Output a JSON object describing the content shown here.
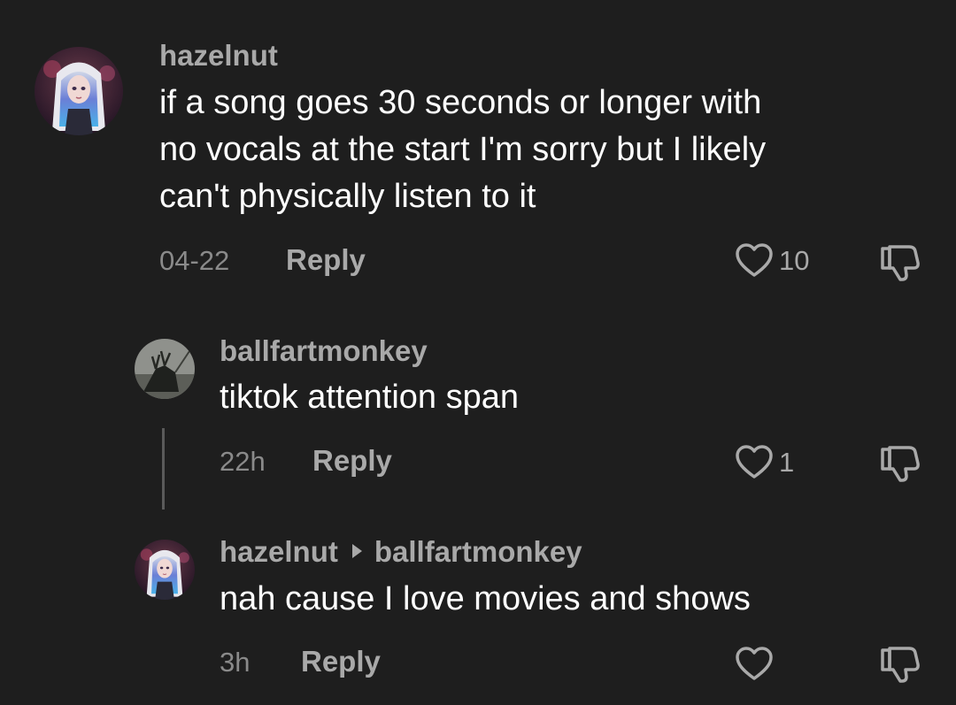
{
  "comments": [
    {
      "username": "hazelnut",
      "text_lines": [
        "if a song goes 30 seconds or longer with",
        "no vocals at the start I'm sorry but I likely",
        "can't physically listen to it"
      ],
      "time": "04-22",
      "reply_label": "Reply",
      "like_count": "10",
      "icons": {
        "avatar": "anime-girl-avatar",
        "like": "heart-icon",
        "dislike": "thumbs-down-icon"
      }
    }
  ],
  "replies": [
    {
      "username": "ballfartmonkey",
      "text": "tiktok attention span",
      "time": "22h",
      "reply_label": "Reply",
      "like_count": "1",
      "icons": {
        "avatar": "dark-creature-avatar",
        "like": "heart-icon",
        "dislike": "thumbs-down-icon"
      }
    },
    {
      "username": "hazelnut",
      "reply_to": "ballfartmonkey",
      "text": "nah cause I love movies and shows",
      "time": "3h",
      "reply_label": "Reply",
      "like_count": "",
      "icons": {
        "avatar": "anime-girl-avatar",
        "like": "heart-icon",
        "dislike": "thumbs-down-icon",
        "reply_arrow": "caret-right-icon"
      }
    }
  ],
  "colors": {
    "background": "#1e1e1e",
    "username": "#a9a9a9",
    "text": "#ffffff",
    "meta": "#8a8a8a"
  }
}
